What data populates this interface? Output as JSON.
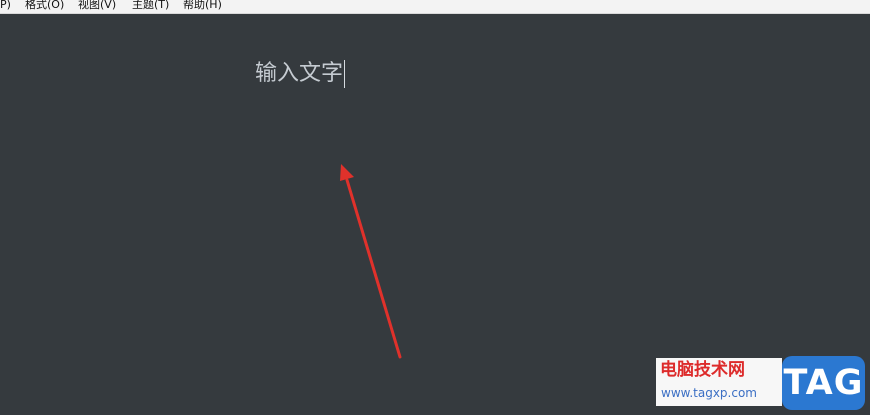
{
  "menubar": {
    "items": [
      {
        "label": "P)"
      },
      {
        "label": "格式(O)"
      },
      {
        "label": "视图(V)"
      },
      {
        "label": "主题(T)"
      },
      {
        "label": "帮助(H)"
      }
    ]
  },
  "editor": {
    "text": "输入文字"
  },
  "annotation": {
    "arrow_color": "#e0312b"
  },
  "watermark": {
    "title": "电脑技术网",
    "url": "www.tagxp.com",
    "badge": "TAG",
    "title_color": "#dd2b2b",
    "url_color": "#3b6fc4",
    "badge_color": "#2b78d1"
  }
}
